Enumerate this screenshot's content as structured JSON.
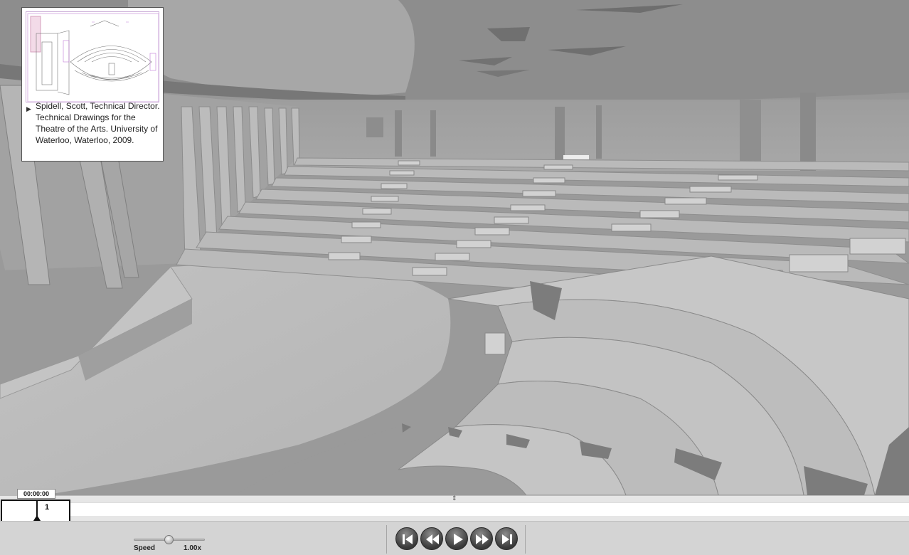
{
  "viewport": {
    "scene": "auditorium-seating-3d-model"
  },
  "reference_card": {
    "caption": "Spidell, Scott, Technical Director. Technical Drawings for the Theatre of the Arts. University of Waterloo, Waterloo, 2009.",
    "arrow_icon": "disclosure-triangle-icon"
  },
  "timeline": {
    "time": "00:00:00",
    "keyframe_number": "1"
  },
  "speed": {
    "label": "Speed",
    "value": "1.00x",
    "level": 0.5
  },
  "transport": {
    "buttons": [
      "go-to-start",
      "rewind",
      "play",
      "fast-forward",
      "go-to-end"
    ]
  },
  "colors": {
    "ui_bg": "#d4d4d4",
    "button_dark": "#3a3a3a"
  }
}
